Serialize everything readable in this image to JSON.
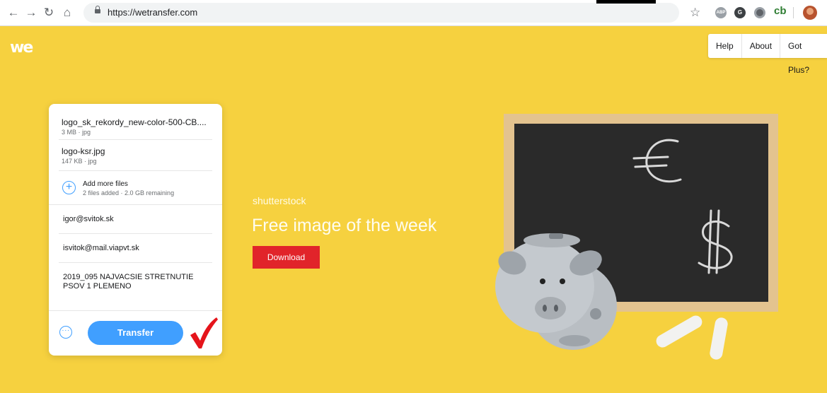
{
  "browser": {
    "url": "https://wetransfer.com",
    "extensions": [
      {
        "name": "abp-icon",
        "label": "ABP",
        "color": "#9aa0a6"
      },
      {
        "name": "grammarly-icon",
        "label": "G",
        "color": "#3c4043"
      },
      {
        "name": "camera-extension-icon",
        "label": "",
        "color": "#5f6368"
      }
    ],
    "cb_label": "cb"
  },
  "header": {
    "nav": [
      "Help",
      "About",
      "Got Plus?"
    ]
  },
  "panel": {
    "files": [
      {
        "name": "logo_sk_rekordy_new-color-500-CB....",
        "meta": "3 MB · jpg"
      },
      {
        "name": "logo-ksr.jpg",
        "meta": "147 KB · jpg"
      }
    ],
    "add_more": {
      "title": "Add more files",
      "meta": "2 files added · 2.0 GB remaining"
    },
    "email_to": "igor@svitok.sk",
    "email_from": "isvitok@mail.viapvt.sk",
    "message": "2019_095 NAJVACSIE STRETNUTIE\nPSOV 1 PLEMENO",
    "transfer_label": "Transfer"
  },
  "ad": {
    "brand": "shutterstock",
    "headline": "Free image of the week",
    "download_label": "Download"
  },
  "colors": {
    "background": "#f6d13f",
    "accent": "#409fff",
    "download": "#e1242a",
    "checkmark": "#e5141b"
  }
}
